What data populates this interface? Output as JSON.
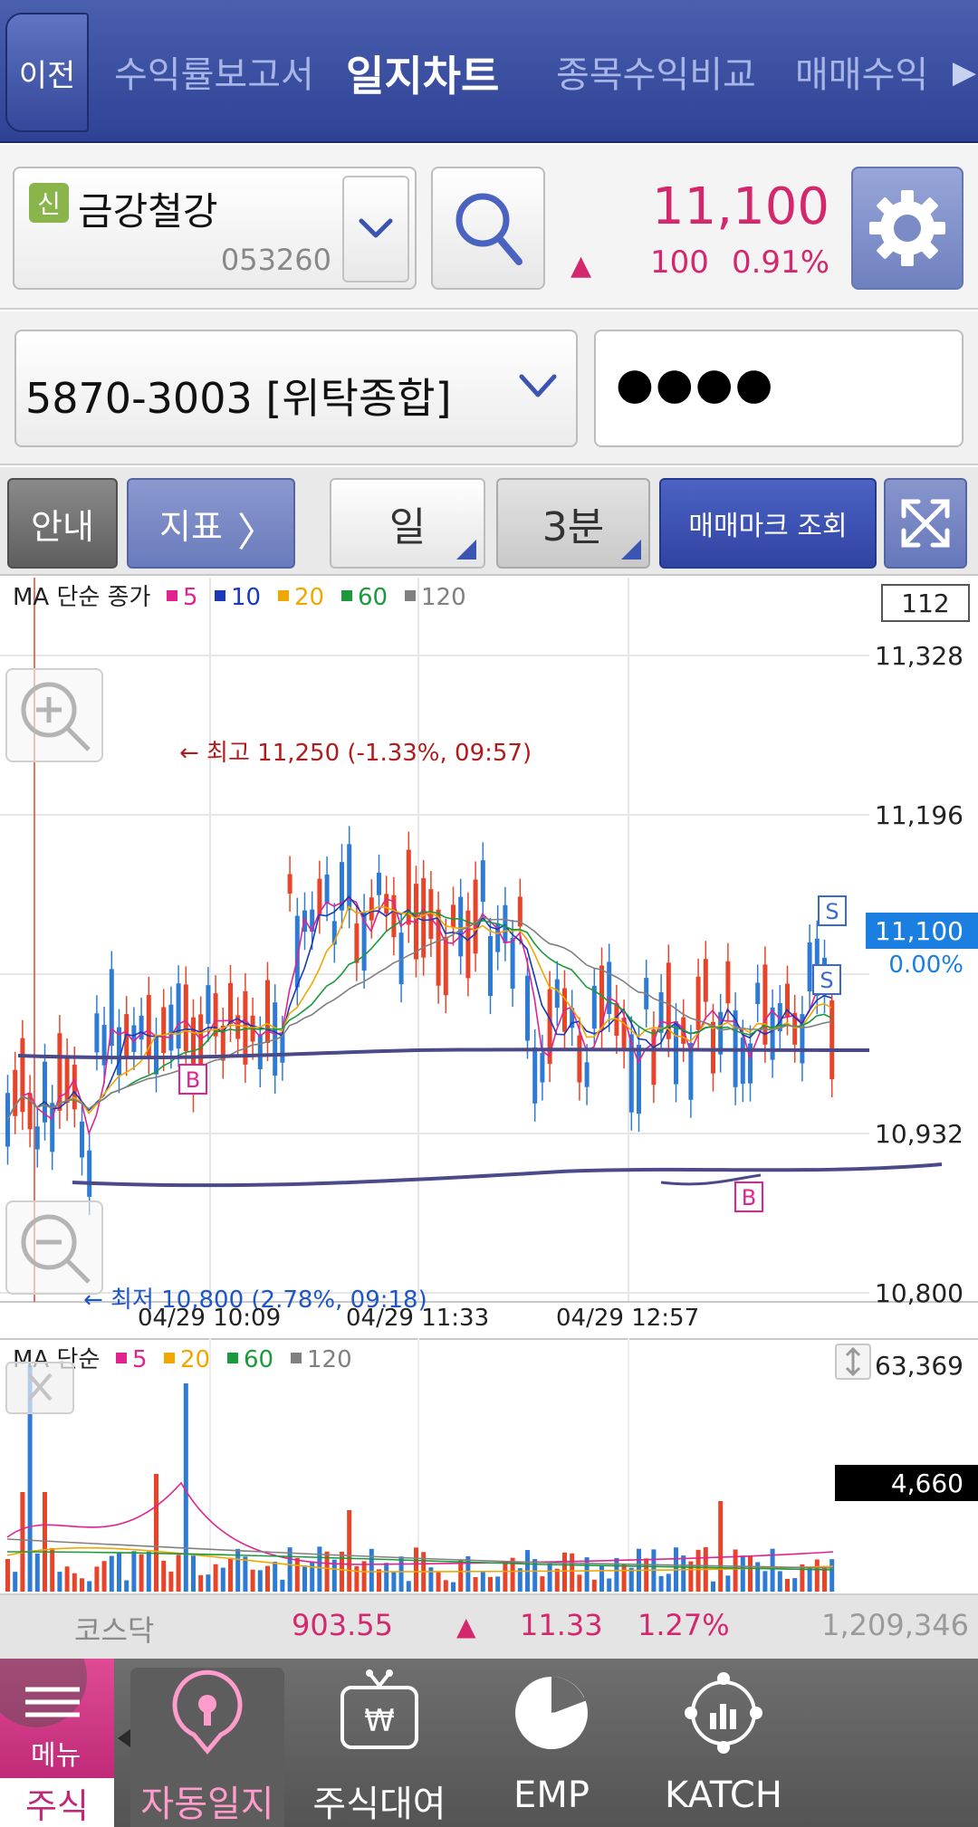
{
  "top_tabs": {
    "back": "이전",
    "items": [
      "수익률보고서",
      "일지차트",
      "종목수익비교",
      "매매수익"
    ],
    "active_index": 1,
    "more_arrow": "▶"
  },
  "stock": {
    "credit_badge": "신",
    "name": "금강철강",
    "code": "053260",
    "price": "11,100",
    "direction": "▲",
    "change": "100",
    "change_rate": "0.91%"
  },
  "account": {
    "selected": "5870-3003 [위탁종합]",
    "password_masked": "●●●●"
  },
  "toolbar": {
    "guide": "안내",
    "indicator": "지표",
    "indicator_arrow": "〉",
    "period": "일",
    "interval": "3분",
    "trade_mark": "매매마크 조회"
  },
  "price_chart": {
    "legend_title": "MA 단순 종가",
    "ma_legend": [
      {
        "label": "5",
        "color": "#e0238f"
      },
      {
        "label": "10",
        "color": "#1a38b8"
      },
      {
        "label": "20",
        "color": "#f0a800"
      },
      {
        "label": "60",
        "color": "#1a9a3a"
      },
      {
        "label": "120",
        "color": "#808080"
      }
    ],
    "count_box": "112",
    "y_ticks": [
      "11,328",
      "11,196",
      "11,100",
      "10,932",
      "10,800"
    ],
    "current_price": "11,100",
    "current_rate": "0.00%",
    "high_annotation": "← 최고 11,250 (-1.33%, 09:57)",
    "low_annotation": "← 최저 10,800 (2.78%, 09:18)",
    "x_ticks": [
      "04/29 10:09",
      "04/29 11:33",
      "04/29 12:57"
    ],
    "buy_mark": "B",
    "sell_mark": "S"
  },
  "volume_chart": {
    "legend_title": "MA 단순",
    "ma_legend": [
      {
        "label": "5",
        "color": "#e0238f"
      },
      {
        "label": "20",
        "color": "#f0a800"
      },
      {
        "label": "60",
        "color": "#1a9a3a"
      },
      {
        "label": "120",
        "color": "#808080"
      }
    ],
    "max_label": "63,369",
    "current_label": "4,660"
  },
  "index_bar": {
    "name": "코스닥",
    "value": "903.55",
    "direction": "▲",
    "change": "11.33",
    "rate": "1.27%",
    "volume": "1,209,346"
  },
  "bottom_nav": {
    "menu": "메뉴",
    "stock": "주식",
    "items": [
      "자동일지",
      "주식대여",
      "EMP",
      "KATCH"
    ],
    "active_index": 0
  },
  "colors": {
    "up": "#d4286e",
    "candle_up": "#e8442a",
    "candle_down": "#2e7bd6",
    "accent": "#2f43a2"
  }
}
